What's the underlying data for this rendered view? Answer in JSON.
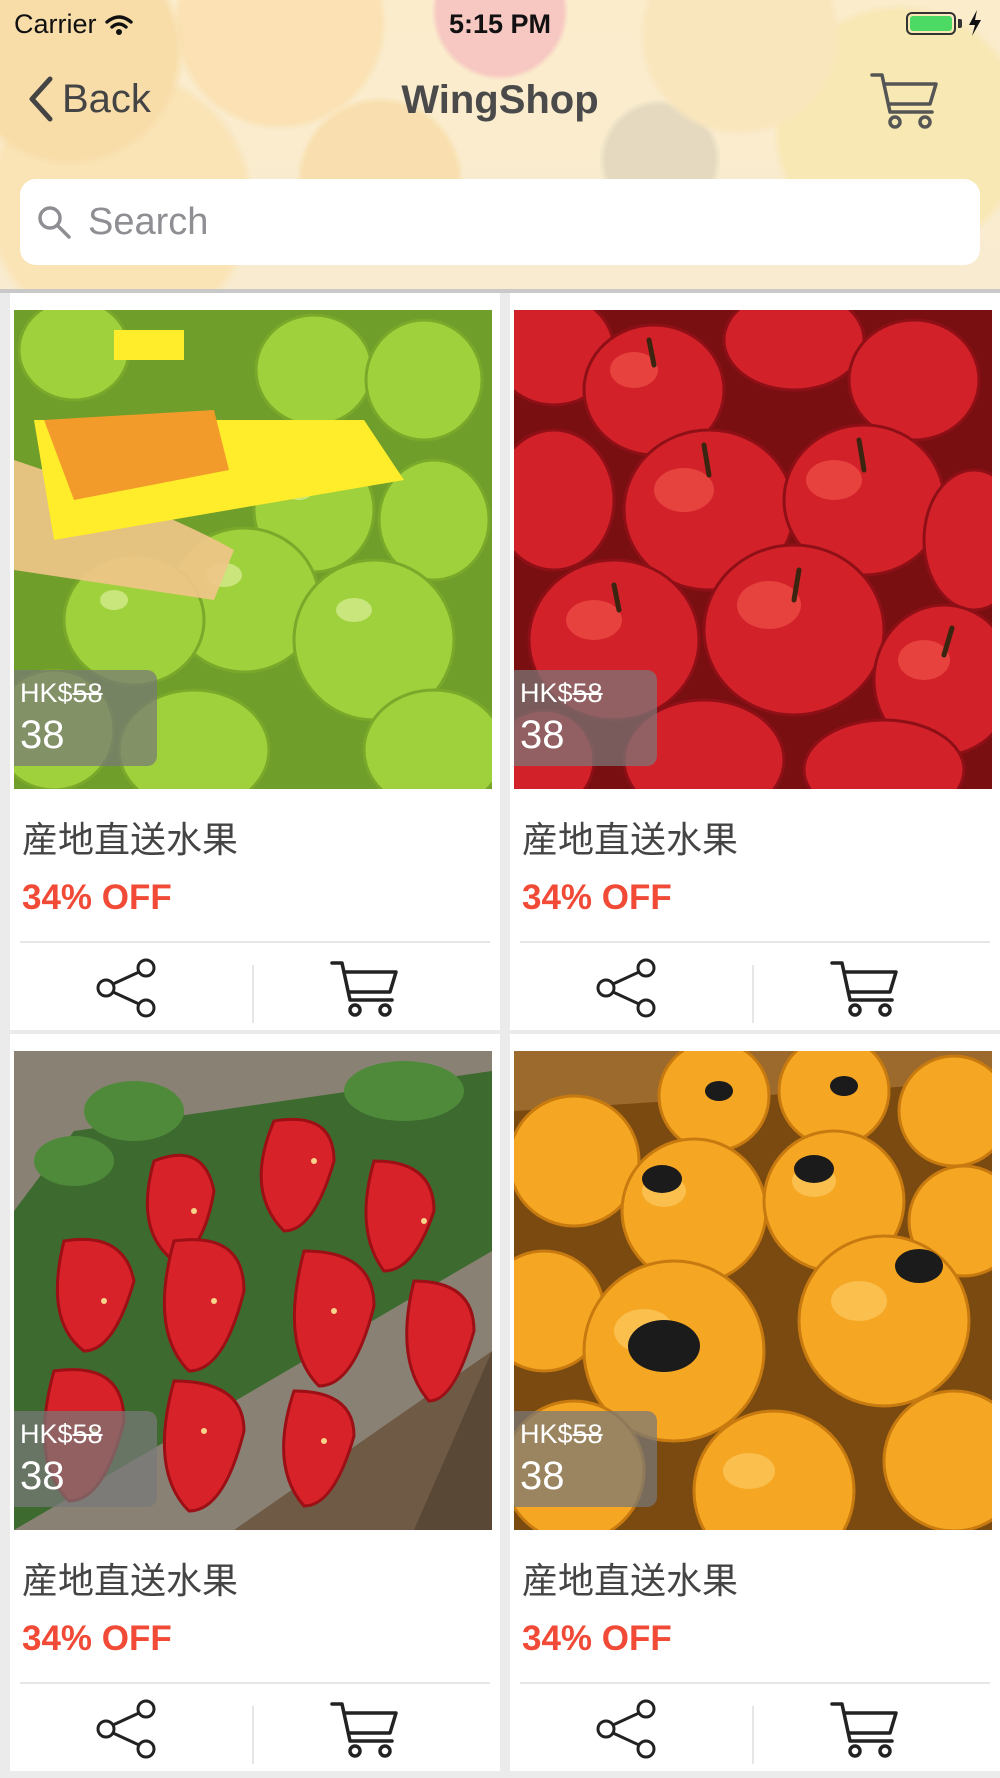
{
  "status_bar": {
    "carrier": "Carrier",
    "time": "5:15 PM"
  },
  "nav": {
    "back_label": "Back",
    "title": "WingShop"
  },
  "search": {
    "placeholder": "Search"
  },
  "products": [
    {
      "fruit": "green grapes",
      "currency": "HK$",
      "original_price": "58",
      "price": "38",
      "title": "産地直送水果",
      "discount": "34% OFF"
    },
    {
      "fruit": "red apples",
      "currency": "HK$",
      "original_price": "58",
      "price": "38",
      "title": "産地直送水果",
      "discount": "34% OFF"
    },
    {
      "fruit": "strawberries",
      "currency": "HK$",
      "original_price": "58",
      "price": "38",
      "title": "産地直送水果",
      "discount": "34% OFF"
    },
    {
      "fruit": "oranges",
      "currency": "HK$",
      "original_price": "58",
      "price": "38",
      "title": "産地直送水果",
      "discount": "34% OFF"
    }
  ],
  "colors": {
    "discount": "#f14a36",
    "battery": "#4cd964"
  },
  "icons": [
    "wifi-icon",
    "battery-icon",
    "chevron-left-icon",
    "cart-icon",
    "search-icon",
    "share-icon"
  ]
}
